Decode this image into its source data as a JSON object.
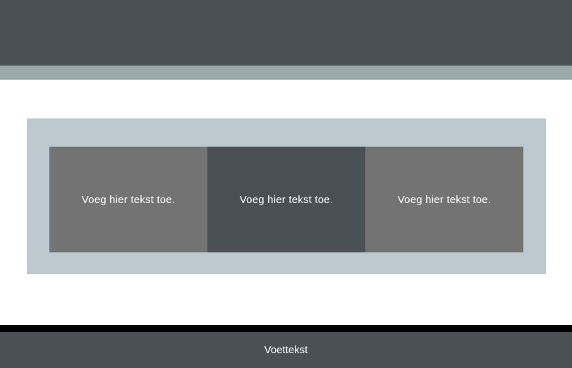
{
  "colors": {
    "header": "#4a5154",
    "subbar": "#9aa8ad",
    "panel": "#bcc9cf",
    "tile_light": "#737373",
    "tile_dark": "#4a5154",
    "footer_divider": "#000000",
    "footer": "#4a5154"
  },
  "tiles": [
    {
      "text": "Voeg hier tekst toe.",
      "color_key": "tile_light"
    },
    {
      "text": "Voeg hier tekst toe.",
      "color_key": "tile_dark"
    },
    {
      "text": "Voeg hier tekst toe.",
      "color_key": "tile_light"
    }
  ],
  "footer": {
    "text": "Voettekst"
  }
}
